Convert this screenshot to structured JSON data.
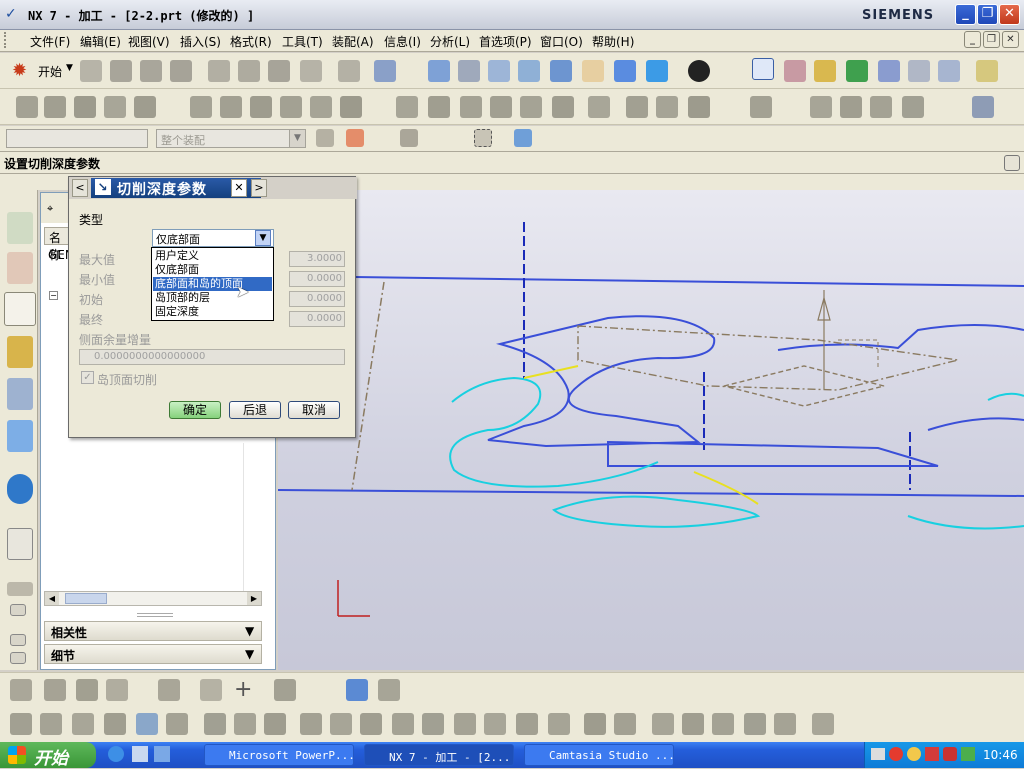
{
  "window": {
    "title": "NX 7 - 加工 - [2-2.prt  (修改的) ]",
    "brand": "SIEMENS",
    "min_glyph": "_",
    "max_glyph": "❐",
    "close_glyph": "✕"
  },
  "menu": {
    "items": [
      "文件(F)",
      "编辑(E)",
      "视图(V)",
      "插入(S)",
      "格式(R)",
      "工具(T)",
      "装配(A)",
      "信息(I)",
      "分析(L)",
      "首选项(P)",
      "窗口(O)",
      "帮助(H)"
    ],
    "start_label": "开始"
  },
  "filterbar": {
    "filter_placeholder": "",
    "assembly_scope": "整个装配"
  },
  "cue": {
    "prompt": "设置切削深度参数"
  },
  "nav_panel": {
    "col_name": "名称",
    "row_gen": "GEN",
    "section_related": "相关性",
    "section_details": "细节"
  },
  "dialog": {
    "title": "切削深度参数",
    "type_label": "类型",
    "type_value": "仅底部面",
    "dropdown_options": [
      "用户定义",
      "仅底部面",
      "底部面和岛的顶面",
      "岛顶部的层",
      "固定深度"
    ],
    "dropdown_highlighted": "底部面和岛的顶面",
    "max_label": "最大值",
    "max_value": "3.0000",
    "min_label": "最小值",
    "min_value": "0.0000",
    "initial_label": "初始",
    "initial_value": "0.0000",
    "final_label": "最终",
    "final_value": "0.0000",
    "side_stock_label": "侧面余量增量",
    "side_stock_value": "0.0000000000000000",
    "island_top_cut_label": "岛顶面切削",
    "ok_label": "确定",
    "back_label": "后退",
    "cancel_label": "取消"
  },
  "taskbar": {
    "start_label": "开始",
    "tasks": [
      "Microsoft PowerP...",
      "NX 7 - 加工 - [2...",
      "Camtasia Studio ..."
    ],
    "clock": "10:46"
  },
  "colors": {
    "accent_title": "#14407e",
    "selection": "#316ac5",
    "geometry_blue": "#3a4fd8",
    "geometry_cyan": "#18d0e0",
    "geometry_yellow": "#e8e020"
  }
}
